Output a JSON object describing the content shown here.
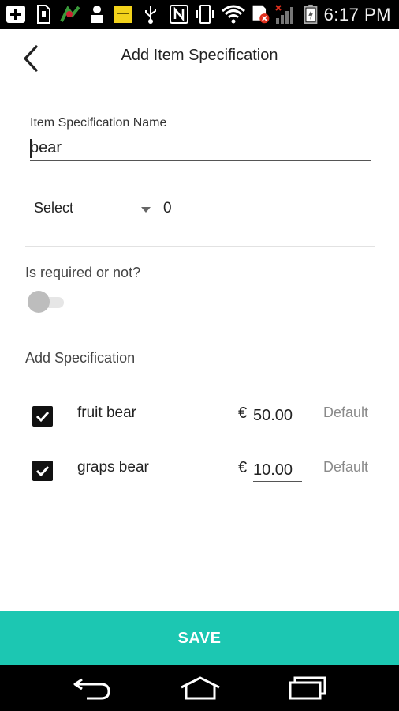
{
  "status_bar": {
    "time": "6:17 PM",
    "icons": [
      "add-icon",
      "sd-card-icon",
      "carrier-icon",
      "person-icon",
      "notes-icon",
      "usb-icon",
      "nfc-icon",
      "vibrate-icon",
      "wifi-icon",
      "sim-error-icon",
      "signal-icon",
      "battery-icon"
    ]
  },
  "header": {
    "title": "Add Item Specification"
  },
  "name_field": {
    "label": "Item Specification Name",
    "value": "bear"
  },
  "select_row": {
    "select_label": "Select",
    "quantity": "0"
  },
  "required": {
    "label": "Is required or not?",
    "enabled": false
  },
  "specs": {
    "title": "Add Specification",
    "items": [
      {
        "name": "fruit bear",
        "currency": "€",
        "price": "50.00",
        "default_label": "Default",
        "checked": true
      },
      {
        "name": "graps bear",
        "currency": "€",
        "price": "10.00",
        "default_label": "Default",
        "checked": true
      }
    ]
  },
  "save": {
    "label": "SAVE"
  },
  "colors": {
    "accent": "#1cc7b2",
    "status_bar": "#000000",
    "nav_bar": "#000000"
  }
}
